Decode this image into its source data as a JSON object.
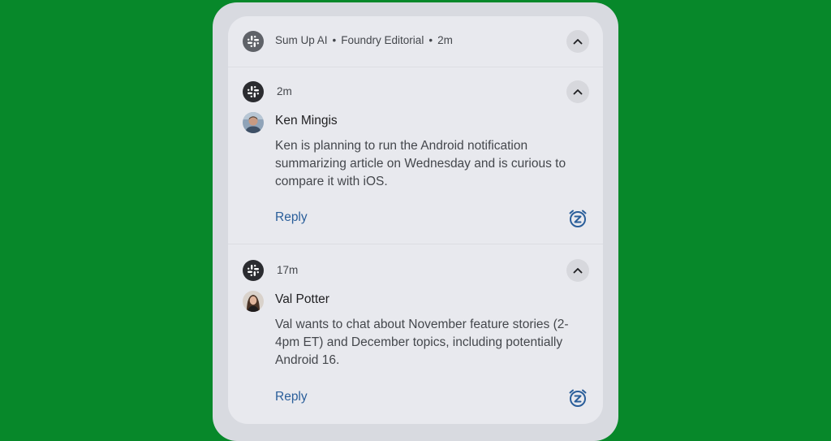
{
  "group_header": {
    "app_name": "Sum Up AI",
    "separator": "•",
    "channel": "Foundry Editorial",
    "time": "2m",
    "app_icon": "slack-icon",
    "collapse_icon": "chevron-up-icon"
  },
  "notifications": [
    {
      "time": "2m",
      "sender": "Ken Mingis",
      "message": "Ken is planning to run the Android notification summarizing article on Wednesday and is curious to compare it with iOS.",
      "reply_label": "Reply",
      "snooze_icon": "snooze-icon",
      "collapse_icon": "chevron-up-icon"
    },
    {
      "time": "17m",
      "sender": "Val Potter",
      "message": "Val wants to chat about November feature stories (2-4pm ET) and December topics, including potentially Android 16.",
      "reply_label": "Reply",
      "snooze_icon": "snooze-icon",
      "collapse_icon": "chevron-up-icon"
    }
  ],
  "colors": {
    "background": "#07882a",
    "panel": "#e8e9ee",
    "reply": "#2a5e9a"
  }
}
